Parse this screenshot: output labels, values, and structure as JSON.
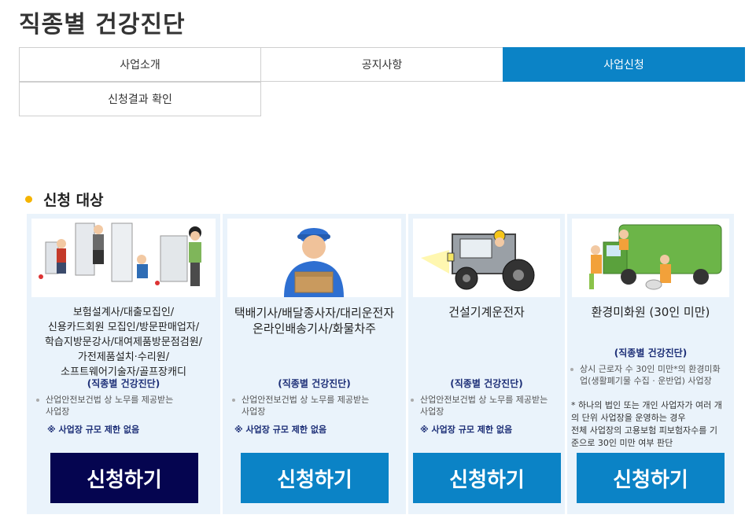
{
  "page": {
    "title": "직종별 건강진단"
  },
  "tabs": [
    {
      "label": "사업소개"
    },
    {
      "label": "공지사항"
    },
    {
      "label": "사업신청"
    },
    {
      "label": "신청결과 확인"
    }
  ],
  "section": {
    "title": "신청 대상"
  },
  "cards": [
    {
      "job_lines": [
        "보험설계사/대출모집인/",
        "신용카드회원 모집인/방문판매업자/",
        "학습지방문강사/대여제품방문점검원/",
        "가전제품설치·수리원/",
        "소프트웨어기술자/골프장캐디"
      ],
      "subtitle": "(직종별 건강진단)",
      "desc_lines": [
        "산업안전보건법 상 노무를 제공받는",
        "사업장"
      ],
      "note": "※ 사업장 규모 제한 없음",
      "button": "신청하기"
    },
    {
      "job_lines": [
        "택배기사/배달종사자/대리운전자",
        "온라인배송기사/화물차주"
      ],
      "subtitle": "(직종별 건강진단)",
      "desc_lines": [
        "산업안전보건법 상 노무를 제공받는",
        "사업장"
      ],
      "note": "※ 사업장 규모 제한 없음",
      "button": "신청하기"
    },
    {
      "job_lines": [
        "건설기계운전자"
      ],
      "subtitle": "(직종별 건강진단)",
      "desc_lines": [
        "산업안전보건법 상 노무를 제공받는",
        "사업장"
      ],
      "note": "※ 사업장 규모 제한 없음",
      "button": "신청하기"
    },
    {
      "job_lines": [
        "환경미화원 (30인 미만)"
      ],
      "subtitle": "(직종별 건강진단)",
      "desc_lines": [
        "상시 근로자 수 30인 미만*의 환경미화",
        "업(생활폐기물 수집 · 운반업) 사업장"
      ],
      "extra_lines": [
        "* 하나의 법인 또는 개인 사업자가 여러 개",
        "의 단위 사업장을 운영하는 경우",
        "전체 사업장의 고용보험 피보험자수를 기",
        "준으로 30인 미만 여부 판단"
      ],
      "button": "신청하기"
    }
  ],
  "colors": {
    "accent": "#0b83c6",
    "dark_button": "#050550",
    "bullet": "#f5b400",
    "subtitle": "#1d2f77"
  }
}
